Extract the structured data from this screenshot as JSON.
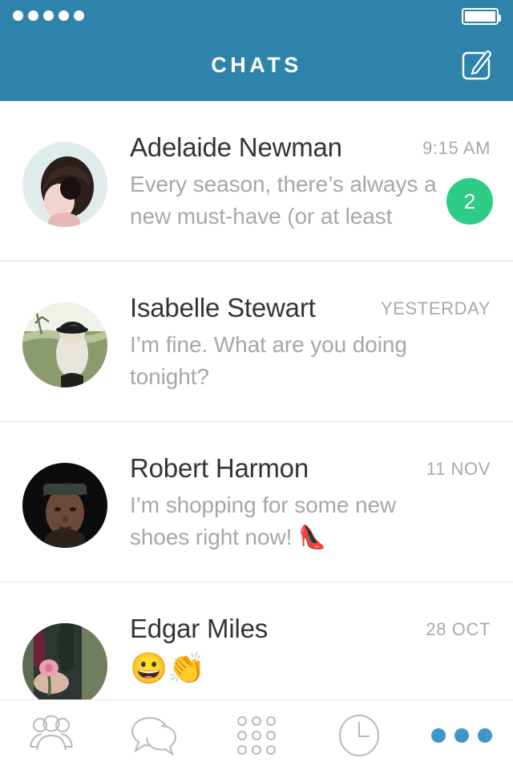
{
  "statusbar": {
    "signal_dots": 5,
    "signal_icon": "signal-dots-icon",
    "battery_icon": "battery-full-icon",
    "battery_level": "full"
  },
  "header": {
    "title": "CHATS",
    "background_color": "#2e83ab",
    "compose_icon": "compose-pencil-icon"
  },
  "colors": {
    "accent": "#2e83ab",
    "badge_green": "#2ecc87",
    "tab_active_blue": "#3f97c9",
    "name_text": "#313538",
    "muted_text": "#a5a7a9",
    "divider": "#e3e3e3"
  },
  "chats": [
    {
      "name": "Adelaide Newman",
      "time": "9:15 AM",
      "preview": "Every season, there’s always a new must-have (or at least",
      "unread_count": "2",
      "avatar_name": "avatar-adelaide-newman",
      "emoji_only": false
    },
    {
      "name": "Isabelle Stewart",
      "time": "YESTERDAY",
      "preview": "I’m fine. What are you doing tonight?",
      "unread_count": "",
      "avatar_name": "avatar-isabelle-stewart",
      "emoji_only": false
    },
    {
      "name": "Robert Harmon",
      "time": "11 NOV",
      "preview": "I’m shopping for some new shoes right now! 👠",
      "unread_count": "",
      "avatar_name": "avatar-robert-harmon",
      "emoji_only": false
    },
    {
      "name": "Edgar Miles",
      "time": "28 OCT",
      "preview": "😀👏",
      "unread_count": "",
      "avatar_name": "avatar-edgar-miles",
      "emoji_only": true
    }
  ],
  "tabbar": {
    "items": [
      {
        "icon": "contacts-group-icon",
        "label": "Contacts",
        "active": false
      },
      {
        "icon": "chat-bubbles-icon",
        "label": "Chats",
        "active": false
      },
      {
        "icon": "keypad-grid-icon",
        "label": "Keypad",
        "active": false
      },
      {
        "icon": "clock-recents-icon",
        "label": "Recents",
        "active": false
      },
      {
        "icon": "more-dots-icon",
        "label": "More",
        "active": true
      }
    ]
  }
}
